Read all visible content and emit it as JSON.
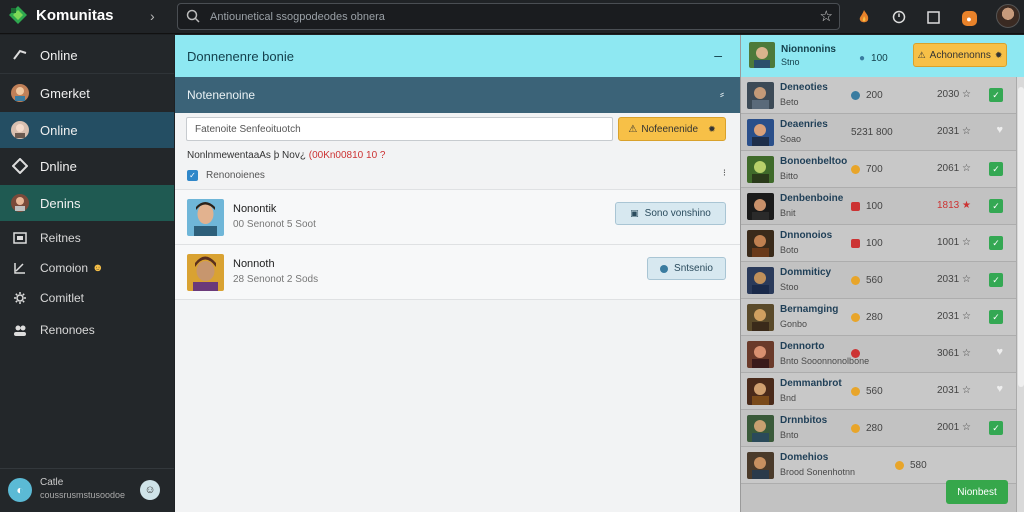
{
  "app": {
    "name": "Komunitas",
    "logo_icon": "diamond-logo-icon"
  },
  "topbar": {
    "search_placeholder": "Antiounetical ssogpodeodes obnera",
    "icons": [
      "star-icon",
      "flame-icon",
      "timer-icon",
      "square-icon",
      "orange-badge-icon",
      "user-avatar"
    ]
  },
  "sidebar": {
    "items": [
      {
        "label": "Online",
        "icon": "arrow-icon"
      },
      {
        "label": "Gmerket",
        "icon": "avatar-icon"
      },
      {
        "label": "Online",
        "icon": "avatar-icon"
      },
      {
        "label": "Dnline",
        "icon": "diamond-icon"
      },
      {
        "label": "Denins",
        "icon": "avatar-icon"
      },
      {
        "label": "Reitnes",
        "icon": "chart-icon"
      },
      {
        "label": "Comoion",
        "icon": "arrow-icon"
      },
      {
        "label": "Comitlet",
        "icon": "gear-icon"
      },
      {
        "label": "Renonoes",
        "icon": "users-icon"
      }
    ],
    "footer": {
      "line1": "Catle",
      "line2": "coussrusmstusoodoe"
    }
  },
  "main": {
    "header_title": "Donnenenre bonie",
    "sub_title": "Notenenoine",
    "filter_value": "Fatenoite Senfeoituotch",
    "filter_button": "Nofeenenide",
    "status_text": "NonlnmewentaaAs þ Nov¿ ",
    "status_red": "(00Kn00810 10 ?",
    "checkbox_label": "Renonoienes",
    "rows": [
      {
        "name": "Nonontik",
        "sub": "00   Senonot 5 Soot",
        "button": "Sono vonshino"
      },
      {
        "name": "Nonnoth",
        "sub": "28   Senonot 2 Sods",
        "button": "Sntsenio"
      }
    ]
  },
  "right": {
    "header": {
      "name": "Nionnonins",
      "sub": "Stno",
      "meta_num": "100",
      "cta": "Achonenonns"
    },
    "rows": [
      {
        "name": "Deneoties",
        "sub": "Beto",
        "meta": "200",
        "score": "2030",
        "status": "check"
      },
      {
        "name": "Deaenries",
        "sub": "Soao",
        "meta": "5231 800",
        "score": "2031",
        "status": "heart"
      },
      {
        "name": "Bonoenbeltoo",
        "sub": "Bitto",
        "meta": "700",
        "score": "2061",
        "status": "check"
      },
      {
        "name": "Denbenboine",
        "sub": "Bnit",
        "meta": "100",
        "score": "1813",
        "status": "check",
        "red": true
      },
      {
        "name": "Dnnonoios",
        "sub": "Boto",
        "meta": "100",
        "score": "1001",
        "status": "check"
      },
      {
        "name": "Dommiticy",
        "sub": "Stoo",
        "meta": "560",
        "score": "2031",
        "status": "check"
      },
      {
        "name": "Bernamging",
        "sub": "Gonbo",
        "meta": "280",
        "score": "2031",
        "status": "check"
      },
      {
        "name": "Dennorto",
        "sub": "Bnto  Sooonnonolbone",
        "meta": "",
        "score": "3061",
        "status": "heart"
      },
      {
        "name": "Demmanbrot",
        "sub": "Bnd",
        "meta": "560",
        "score": "2031",
        "status": "heart"
      },
      {
        "name": "Drnnbitos",
        "sub": "Bnto",
        "meta": "280",
        "score": "2001",
        "status": "check"
      },
      {
        "name": "Domehios",
        "sub": "Brood  Sonenhotnn",
        "meta": "580",
        "score": "",
        "status": "none"
      }
    ],
    "green_button": "Nionbest"
  }
}
